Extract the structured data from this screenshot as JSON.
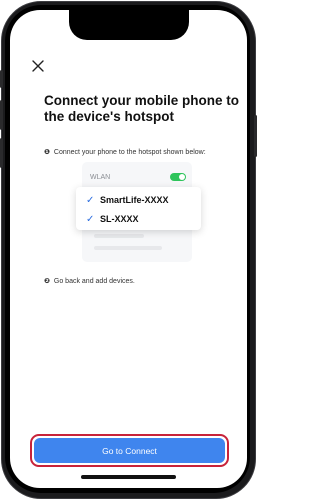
{
  "screen": {
    "title": "Connect your mobile phone to the device's hotspot",
    "close_icon": "close-icon"
  },
  "steps": [
    {
      "number": "❶",
      "text": "Connect your phone to the hotspot shown below:"
    },
    {
      "number": "❷",
      "text": "Go back and add devices."
    }
  ],
  "illustration": {
    "wlan_label": "WLAN",
    "wlan_enabled": true,
    "check_icon": "check-icon",
    "networks": [
      {
        "name": "SmartLife-XXXX",
        "checked": true
      },
      {
        "name": "SL-XXXX",
        "checked": true
      }
    ]
  },
  "actions": {
    "connect_label": "Go to Connect"
  },
  "colors": {
    "primary": "#3f85ee",
    "highlight_border": "#c8233a",
    "toggle_on": "#2ec45b",
    "check": "#2e6fe0"
  }
}
